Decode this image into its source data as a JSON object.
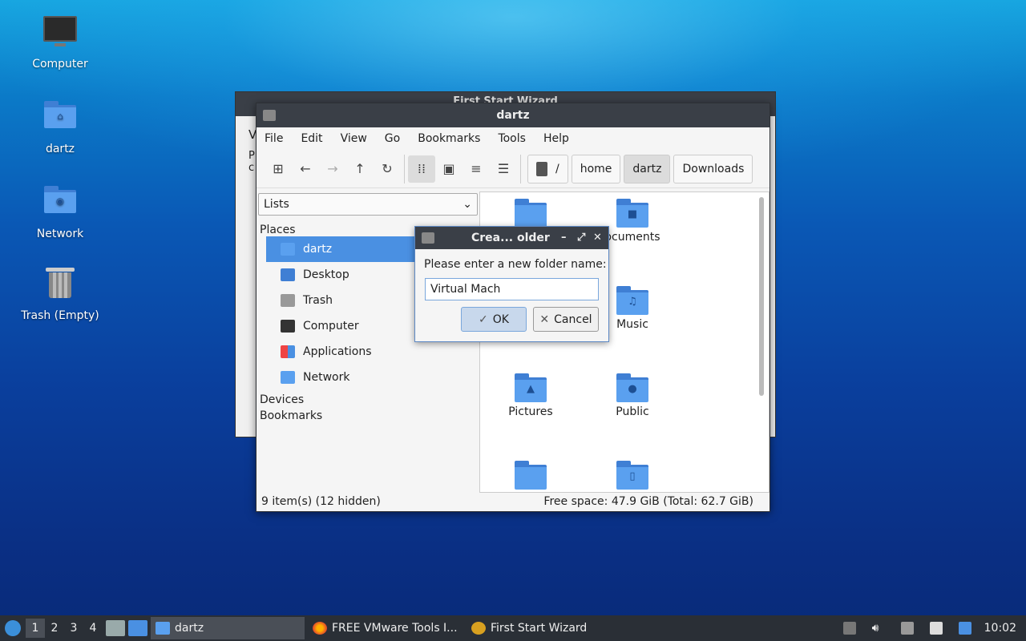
{
  "desktop": {
    "icons": [
      {
        "label": "Computer"
      },
      {
        "label": "dartz"
      },
      {
        "label": "Network"
      },
      {
        "label": "Trash (Empty)"
      }
    ]
  },
  "wizard": {
    "title": "First Start Wizard",
    "text_fragment_1": "V",
    "text_fragment_2": "P",
    "text_fragment_3": "c"
  },
  "file_manager": {
    "title": "dartz",
    "menu": [
      "File",
      "Edit",
      "View",
      "Go",
      "Bookmarks",
      "Tools",
      "Help"
    ],
    "path": [
      "/",
      "home",
      "dartz",
      "Downloads"
    ],
    "side_select": "Lists",
    "places_heading": "Places",
    "places": [
      "dartz",
      "Desktop",
      "Trash",
      "Computer",
      "Applications",
      "Network"
    ],
    "devices_heading": "Devices",
    "bookmarks_heading": "Bookmarks",
    "items": [
      "",
      "ocuments",
      "",
      "Music",
      "Pictures",
      "Public",
      "",
      ""
    ],
    "status_left": "9 item(s) (12 hidden)",
    "status_right": "Free space: 47.9 GiB (Total: 62.7 GiB)"
  },
  "dialog": {
    "title": "Crea... older",
    "prompt": "Please enter a new folder name:",
    "input_value": "Virtual Mach",
    "ok_label": "OK",
    "cancel_label": "Cancel"
  },
  "taskbar": {
    "workspaces": [
      "1",
      "2",
      "3",
      "4"
    ],
    "tasks": [
      "dartz",
      "FREE VMware Tools I...",
      "First Start Wizard"
    ],
    "clock": "10:02"
  },
  "colors": {
    "selection": "#4a90e2",
    "titlebar": "#3a3f47",
    "folder": "#5aa0ef"
  }
}
